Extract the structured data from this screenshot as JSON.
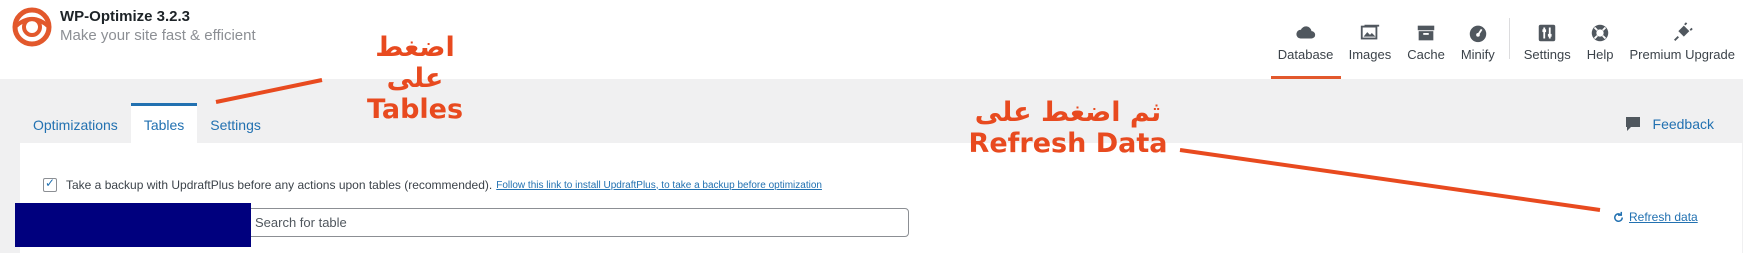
{
  "brand": {
    "title": "WP-Optimize 3.2.3",
    "subtitle": "Make your site fast & efficient"
  },
  "top_nav": [
    {
      "label": "Database",
      "icon": "cloud-icon",
      "active": true
    },
    {
      "label": "Images",
      "icon": "images-icon",
      "active": false
    },
    {
      "label": "Cache",
      "icon": "archive-icon",
      "active": false
    },
    {
      "label": "Minify",
      "icon": "dashboard-icon",
      "active": false
    },
    {
      "label": "Settings",
      "icon": "sliders-icon",
      "active": false
    },
    {
      "label": "Help",
      "icon": "lifebuoy-icon",
      "active": false
    },
    {
      "label": "Premium Upgrade",
      "icon": "plug-icon",
      "active": false
    }
  ],
  "tabs": [
    {
      "label": "Optimizations",
      "active": false
    },
    {
      "label": "Tables",
      "active": true
    },
    {
      "label": "Settings",
      "active": false
    }
  ],
  "feedback_label": "Feedback",
  "backup": {
    "checked": true,
    "label": "Take a backup with UpdraftPlus before any actions upon tables (recommended).",
    "link": "Follow this link to install UpdraftPlus, to take a backup before optimization"
  },
  "search": {
    "placeholder": "Search for table",
    "value": ""
  },
  "refresh_label": "Refresh data",
  "annotations": {
    "tables_line1": "اضغط على",
    "tables_line2": "Tables",
    "refresh_line1": "ثم اضغط على",
    "refresh_line2": "Refresh Data",
    "color": "#e84a1f"
  },
  "colors": {
    "accent": "#e2582c",
    "link": "#2271b1",
    "redaction": "#00007e"
  }
}
